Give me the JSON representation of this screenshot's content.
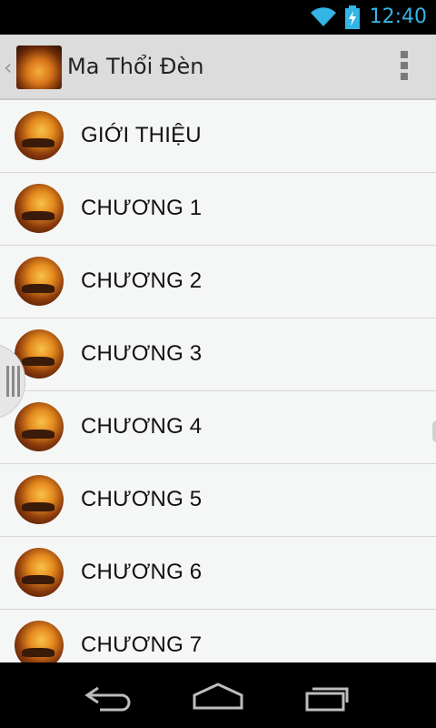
{
  "status_bar": {
    "time": "12:40",
    "accent_color": "#33b5e5",
    "icons": [
      "wifi-icon",
      "battery-charging-icon"
    ]
  },
  "action_bar": {
    "title": "Ma Thổi Đèn",
    "icon_name": "book-cover-icon",
    "up_icon": "up-caret-icon",
    "overflow_icon": "overflow-menu-icon"
  },
  "list": {
    "items": [
      {
        "label": "GIỚI THIỆU"
      },
      {
        "label": "CHƯƠNG 1"
      },
      {
        "label": "CHƯƠNG 2"
      },
      {
        "label": "CHƯƠNG 3"
      },
      {
        "label": "CHƯƠNG 4"
      },
      {
        "label": "CHƯƠNG 5"
      },
      {
        "label": "CHƯƠNG 6"
      },
      {
        "label": "CHƯƠNG 7"
      }
    ]
  },
  "nav_bar": {
    "buttons": [
      "back-icon",
      "home-icon",
      "recents-icon"
    ]
  }
}
